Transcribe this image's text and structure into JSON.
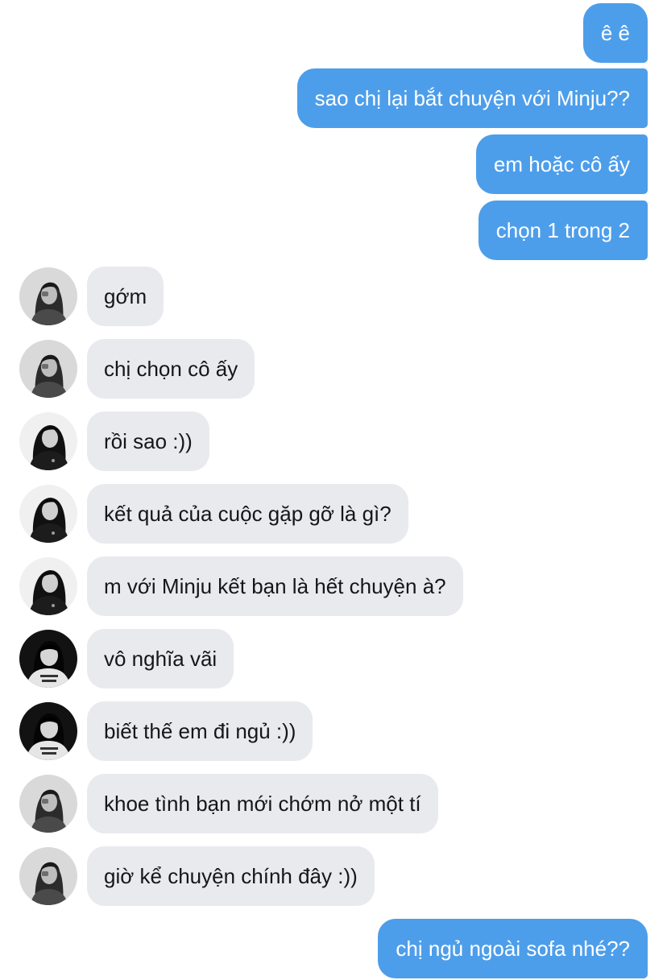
{
  "messages": [
    {
      "side": "out",
      "text": "ê ê"
    },
    {
      "side": "out",
      "text": "sao chị lại bắt chuyện với Minju??"
    },
    {
      "side": "out",
      "text": "em hoặc cô ấy"
    },
    {
      "side": "out",
      "text": "chọn 1 trong 2"
    },
    {
      "side": "in",
      "avatar": "avatar-a",
      "text": "gớm"
    },
    {
      "side": "in",
      "avatar": "avatar-a",
      "text": "chị chọn cô ấy"
    },
    {
      "side": "in",
      "avatar": "avatar-b",
      "text": "rồi sao :))"
    },
    {
      "side": "in",
      "avatar": "avatar-b",
      "text": "kết quả của cuộc gặp gỡ là gì?"
    },
    {
      "side": "in",
      "avatar": "avatar-b",
      "text": "m với Minju kết bạn là hết chuyện à?"
    },
    {
      "side": "in",
      "avatar": "avatar-c",
      "text": "vô nghĩa vãi"
    },
    {
      "side": "in",
      "avatar": "avatar-c",
      "text": "biết thế em đi ngủ :))"
    },
    {
      "side": "in",
      "avatar": "avatar-a",
      "text": "khoe tình bạn mới chớm nở một tí"
    },
    {
      "side": "in",
      "avatar": "avatar-a",
      "text": "giờ kể chuyện chính đây :))"
    },
    {
      "side": "out",
      "text": "chị ngủ ngoài sofa nhé??"
    }
  ],
  "colors": {
    "outgoing_bubble": "#4d9eea",
    "outgoing_text": "#ffffff",
    "incoming_bubble": "#e8eaee",
    "incoming_text": "#14171a"
  }
}
